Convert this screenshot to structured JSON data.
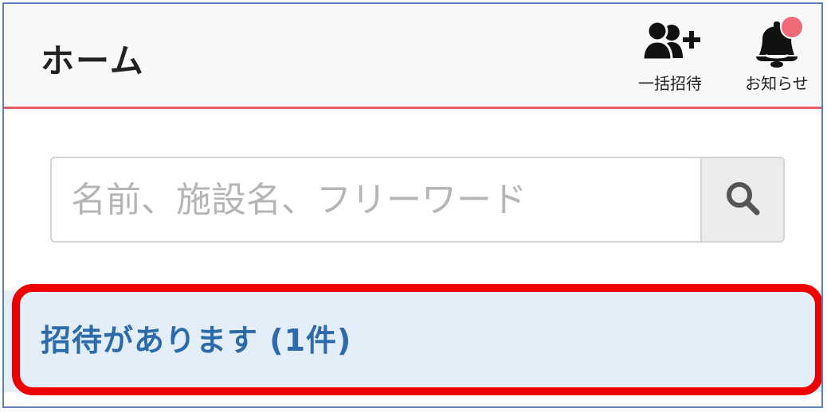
{
  "header": {
    "title": "ホーム",
    "invite_all_label": "一括招待",
    "notifications_label": "お知らせ",
    "accent_color": "#e85a62",
    "badge_color": "#f06a78"
  },
  "search": {
    "placeholder": "名前、施設名、フリーワード",
    "value": "",
    "button_icon": "search-icon"
  },
  "invitations": {
    "banner_text": "招待があります (1件)",
    "text_color": "#2d6aaa",
    "background": "#e3eef8"
  },
  "annotation": {
    "highlight_color": "#ee0000"
  }
}
